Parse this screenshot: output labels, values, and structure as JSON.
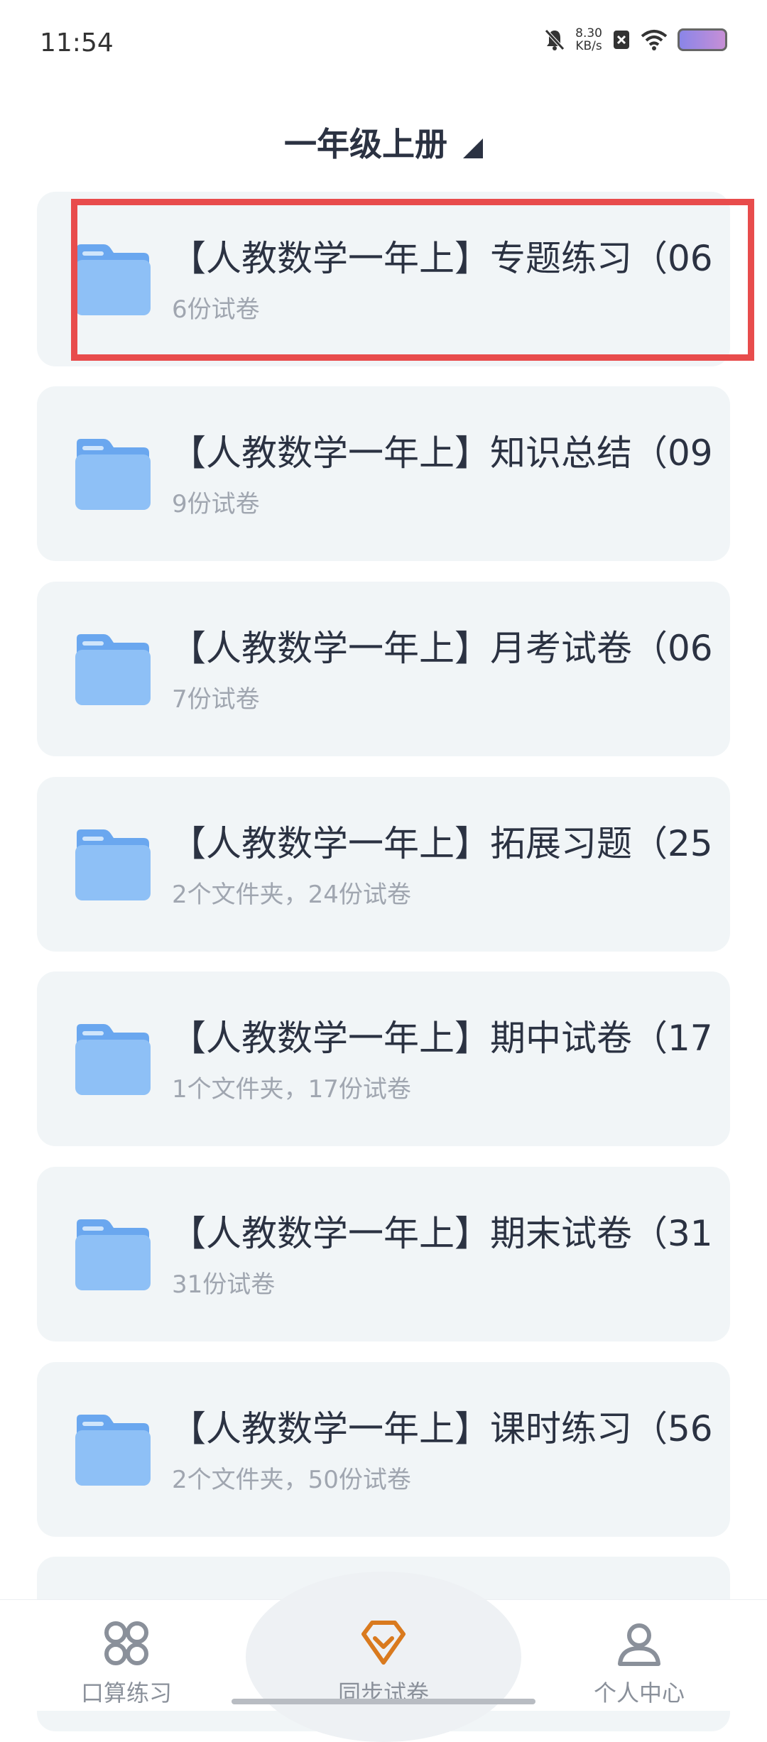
{
  "status_bar": {
    "time": "11:54",
    "net_speed_value": "8.30",
    "net_speed_unit": "KB/s"
  },
  "header": {
    "title": "一年级上册"
  },
  "folders": [
    {
      "title": "【人教数学一年上】专题练习（06",
      "subtitle": "6份试卷"
    },
    {
      "title": "【人教数学一年上】知识总结（09",
      "subtitle": "9份试卷"
    },
    {
      "title": "【人教数学一年上】月考试卷（06",
      "subtitle": "7份试卷"
    },
    {
      "title": "【人教数学一年上】拓展习题（25",
      "subtitle": "2个文件夹，24份试卷"
    },
    {
      "title": "【人教数学一年上】期中试卷（17",
      "subtitle": "1个文件夹，17份试卷"
    },
    {
      "title": "【人教数学一年上】期末试卷（31",
      "subtitle": "31份试卷"
    },
    {
      "title": "【人教数学一年上】课时练习（56",
      "subtitle": "2个文件夹，50份试卷"
    }
  ],
  "bottom_nav": {
    "items": [
      {
        "label": "口算练习",
        "icon": "apps-icon"
      },
      {
        "label": "同步试卷",
        "icon": "diamond-check-icon",
        "active": true
      },
      {
        "label": "个人中心",
        "icon": "person-icon"
      }
    ]
  },
  "colors": {
    "accent": "#d97a1e",
    "highlight": "#e84c4c",
    "card_bg": "#f1f5f7"
  }
}
